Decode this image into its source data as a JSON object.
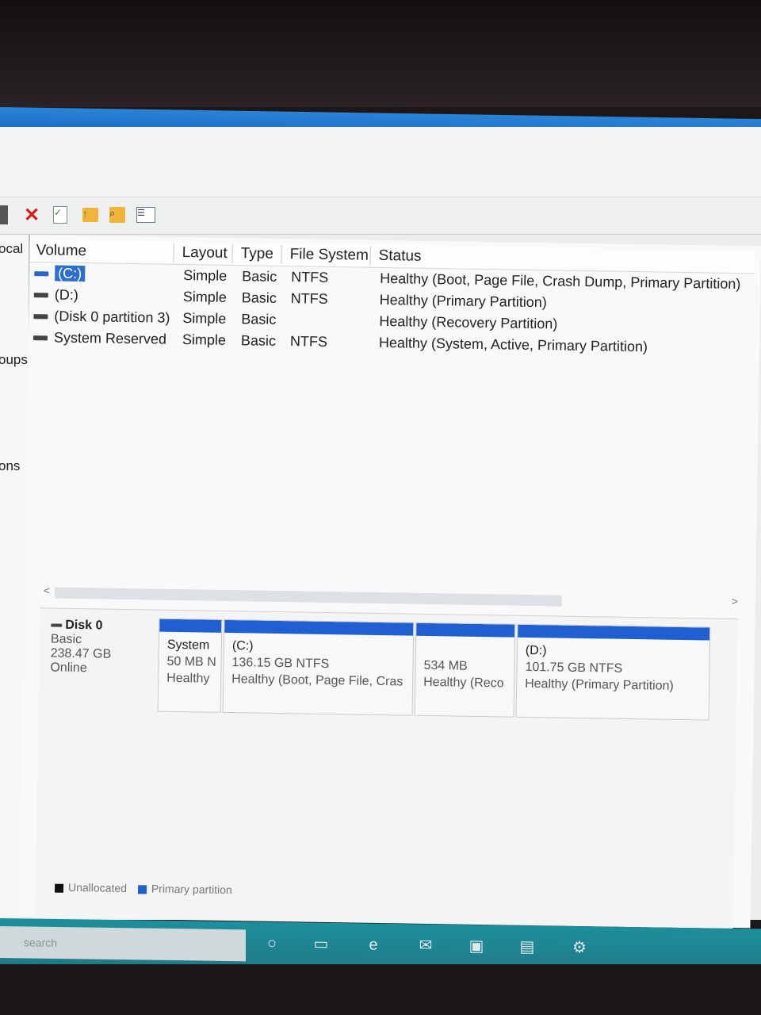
{
  "toolbar": {
    "icons": [
      "back-icon",
      "delete-icon",
      "check-document-icon",
      "up-folder-icon",
      "find-icon",
      "properties-icon"
    ]
  },
  "left_pane": {
    "items": [
      "ocal",
      "oups",
      "ons"
    ]
  },
  "volume_list": {
    "headers": [
      "Volume",
      "Layout",
      "Type",
      "File System",
      "Status"
    ],
    "rows": [
      {
        "volume": "(C:)",
        "layout": "Simple",
        "type": "Basic",
        "fs": "NTFS",
        "status": "Healthy (Boot, Page File, Crash Dump, Primary Partition)",
        "selected": true
      },
      {
        "volume": "(D:)",
        "layout": "Simple",
        "type": "Basic",
        "fs": "NTFS",
        "status": "Healthy (Primary Partition)",
        "selected": false
      },
      {
        "volume": "(Disk 0 partition 3)",
        "layout": "Simple",
        "type": "Basic",
        "fs": "",
        "status": "Healthy (Recovery Partition)",
        "selected": false
      },
      {
        "volume": "System Reserved",
        "layout": "Simple",
        "type": "Basic",
        "fs": "NTFS",
        "status": "Healthy (System, Active, Primary Partition)",
        "selected": false
      }
    ]
  },
  "scrollbar": {
    "left_arrow": "<",
    "right_arrow": ">"
  },
  "disk": {
    "name": "Disk 0",
    "type": "Basic",
    "size": "238.47 GB",
    "state": "Online",
    "partitions": [
      {
        "title": "System",
        "size": "50 MB N",
        "status": "Healthy"
      },
      {
        "title": "(C:)",
        "size": "136.15 GB NTFS",
        "status": "Healthy (Boot, Page File, Cras"
      },
      {
        "title": "",
        "size": "534 MB",
        "status": "Healthy (Reco"
      },
      {
        "title": "(D:)",
        "size": "101.75 GB NTFS",
        "status": "Healthy (Primary Partition)"
      }
    ]
  },
  "legend": {
    "unallocated": "Unallocated",
    "primary": "Primary partition",
    "unallocated_color": "#111111",
    "primary_color": "#1f5fd2"
  },
  "taskbar": {
    "search_placeholder": "search",
    "icons": [
      "cortana-icon",
      "task-view-icon",
      "edge-icon",
      "mail-icon",
      "store-icon",
      "explorer-icon",
      "settings-icon"
    ]
  }
}
